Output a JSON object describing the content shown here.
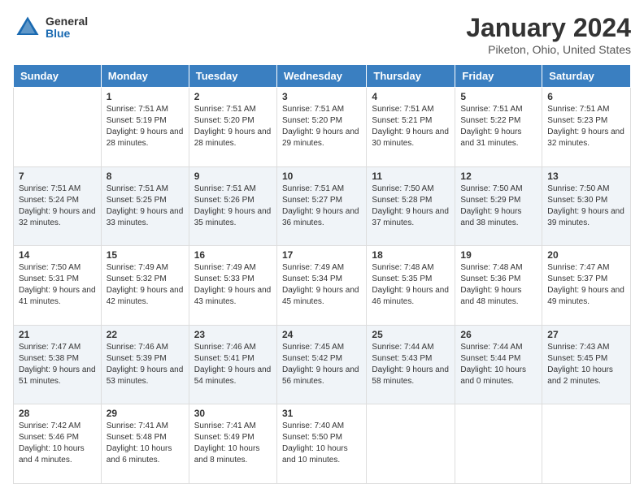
{
  "header": {
    "logo_general": "General",
    "logo_blue": "Blue",
    "month_title": "January 2024",
    "location": "Piketon, Ohio, United States"
  },
  "days_of_week": [
    "Sunday",
    "Monday",
    "Tuesday",
    "Wednesday",
    "Thursday",
    "Friday",
    "Saturday"
  ],
  "weeks": [
    [
      {
        "day": "",
        "sunrise": "",
        "sunset": "",
        "daylight": ""
      },
      {
        "day": "1",
        "sunrise": "Sunrise: 7:51 AM",
        "sunset": "Sunset: 5:19 PM",
        "daylight": "Daylight: 9 hours and 28 minutes."
      },
      {
        "day": "2",
        "sunrise": "Sunrise: 7:51 AM",
        "sunset": "Sunset: 5:20 PM",
        "daylight": "Daylight: 9 hours and 28 minutes."
      },
      {
        "day": "3",
        "sunrise": "Sunrise: 7:51 AM",
        "sunset": "Sunset: 5:20 PM",
        "daylight": "Daylight: 9 hours and 29 minutes."
      },
      {
        "day": "4",
        "sunrise": "Sunrise: 7:51 AM",
        "sunset": "Sunset: 5:21 PM",
        "daylight": "Daylight: 9 hours and 30 minutes."
      },
      {
        "day": "5",
        "sunrise": "Sunrise: 7:51 AM",
        "sunset": "Sunset: 5:22 PM",
        "daylight": "Daylight: 9 hours and 31 minutes."
      },
      {
        "day": "6",
        "sunrise": "Sunrise: 7:51 AM",
        "sunset": "Sunset: 5:23 PM",
        "daylight": "Daylight: 9 hours and 32 minutes."
      }
    ],
    [
      {
        "day": "7",
        "sunrise": "Sunrise: 7:51 AM",
        "sunset": "Sunset: 5:24 PM",
        "daylight": "Daylight: 9 hours and 32 minutes."
      },
      {
        "day": "8",
        "sunrise": "Sunrise: 7:51 AM",
        "sunset": "Sunset: 5:25 PM",
        "daylight": "Daylight: 9 hours and 33 minutes."
      },
      {
        "day": "9",
        "sunrise": "Sunrise: 7:51 AM",
        "sunset": "Sunset: 5:26 PM",
        "daylight": "Daylight: 9 hours and 35 minutes."
      },
      {
        "day": "10",
        "sunrise": "Sunrise: 7:51 AM",
        "sunset": "Sunset: 5:27 PM",
        "daylight": "Daylight: 9 hours and 36 minutes."
      },
      {
        "day": "11",
        "sunrise": "Sunrise: 7:50 AM",
        "sunset": "Sunset: 5:28 PM",
        "daylight": "Daylight: 9 hours and 37 minutes."
      },
      {
        "day": "12",
        "sunrise": "Sunrise: 7:50 AM",
        "sunset": "Sunset: 5:29 PM",
        "daylight": "Daylight: 9 hours and 38 minutes."
      },
      {
        "day": "13",
        "sunrise": "Sunrise: 7:50 AM",
        "sunset": "Sunset: 5:30 PM",
        "daylight": "Daylight: 9 hours and 39 minutes."
      }
    ],
    [
      {
        "day": "14",
        "sunrise": "Sunrise: 7:50 AM",
        "sunset": "Sunset: 5:31 PM",
        "daylight": "Daylight: 9 hours and 41 minutes."
      },
      {
        "day": "15",
        "sunrise": "Sunrise: 7:49 AM",
        "sunset": "Sunset: 5:32 PM",
        "daylight": "Daylight: 9 hours and 42 minutes."
      },
      {
        "day": "16",
        "sunrise": "Sunrise: 7:49 AM",
        "sunset": "Sunset: 5:33 PM",
        "daylight": "Daylight: 9 hours and 43 minutes."
      },
      {
        "day": "17",
        "sunrise": "Sunrise: 7:49 AM",
        "sunset": "Sunset: 5:34 PM",
        "daylight": "Daylight: 9 hours and 45 minutes."
      },
      {
        "day": "18",
        "sunrise": "Sunrise: 7:48 AM",
        "sunset": "Sunset: 5:35 PM",
        "daylight": "Daylight: 9 hours and 46 minutes."
      },
      {
        "day": "19",
        "sunrise": "Sunrise: 7:48 AM",
        "sunset": "Sunset: 5:36 PM",
        "daylight": "Daylight: 9 hours and 48 minutes."
      },
      {
        "day": "20",
        "sunrise": "Sunrise: 7:47 AM",
        "sunset": "Sunset: 5:37 PM",
        "daylight": "Daylight: 9 hours and 49 minutes."
      }
    ],
    [
      {
        "day": "21",
        "sunrise": "Sunrise: 7:47 AM",
        "sunset": "Sunset: 5:38 PM",
        "daylight": "Daylight: 9 hours and 51 minutes."
      },
      {
        "day": "22",
        "sunrise": "Sunrise: 7:46 AM",
        "sunset": "Sunset: 5:39 PM",
        "daylight": "Daylight: 9 hours and 53 minutes."
      },
      {
        "day": "23",
        "sunrise": "Sunrise: 7:46 AM",
        "sunset": "Sunset: 5:41 PM",
        "daylight": "Daylight: 9 hours and 54 minutes."
      },
      {
        "day": "24",
        "sunrise": "Sunrise: 7:45 AM",
        "sunset": "Sunset: 5:42 PM",
        "daylight": "Daylight: 9 hours and 56 minutes."
      },
      {
        "day": "25",
        "sunrise": "Sunrise: 7:44 AM",
        "sunset": "Sunset: 5:43 PM",
        "daylight": "Daylight: 9 hours and 58 minutes."
      },
      {
        "day": "26",
        "sunrise": "Sunrise: 7:44 AM",
        "sunset": "Sunset: 5:44 PM",
        "daylight": "Daylight: 10 hours and 0 minutes."
      },
      {
        "day": "27",
        "sunrise": "Sunrise: 7:43 AM",
        "sunset": "Sunset: 5:45 PM",
        "daylight": "Daylight: 10 hours and 2 minutes."
      }
    ],
    [
      {
        "day": "28",
        "sunrise": "Sunrise: 7:42 AM",
        "sunset": "Sunset: 5:46 PM",
        "daylight": "Daylight: 10 hours and 4 minutes."
      },
      {
        "day": "29",
        "sunrise": "Sunrise: 7:41 AM",
        "sunset": "Sunset: 5:48 PM",
        "daylight": "Daylight: 10 hours and 6 minutes."
      },
      {
        "day": "30",
        "sunrise": "Sunrise: 7:41 AM",
        "sunset": "Sunset: 5:49 PM",
        "daylight": "Daylight: 10 hours and 8 minutes."
      },
      {
        "day": "31",
        "sunrise": "Sunrise: 7:40 AM",
        "sunset": "Sunset: 5:50 PM",
        "daylight": "Daylight: 10 hours and 10 minutes."
      },
      {
        "day": "",
        "sunrise": "",
        "sunset": "",
        "daylight": ""
      },
      {
        "day": "",
        "sunrise": "",
        "sunset": "",
        "daylight": ""
      },
      {
        "day": "",
        "sunrise": "",
        "sunset": "",
        "daylight": ""
      }
    ]
  ]
}
